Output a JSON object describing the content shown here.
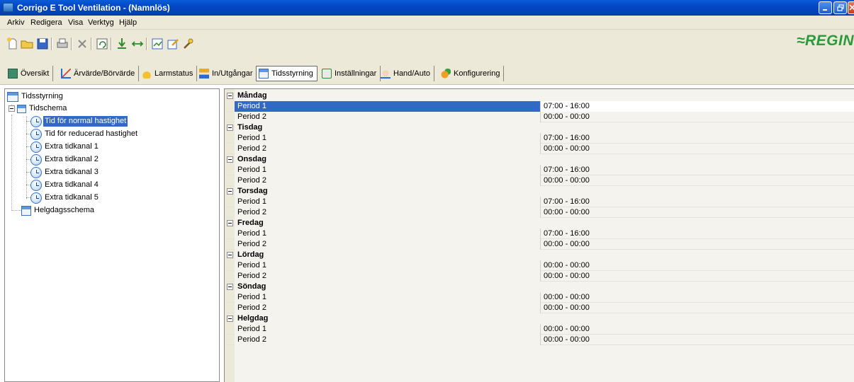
{
  "window": {
    "title": "Corrigo E Tool Ventilation - (Namnlös)"
  },
  "menu": [
    "Arkiv",
    "Redigera",
    "Visa",
    "Verktyg",
    "Hjälp"
  ],
  "brand": {
    "logo_text": "≈REGIN",
    "color": "#2a9a3a"
  },
  "tabs": [
    {
      "label": "Översikt",
      "icon": "overview-icon"
    },
    {
      "label": "Ärvärde/Börvärde",
      "icon": "setpoint-icon"
    },
    {
      "label": "Larmstatus",
      "icon": "alarm-bell-icon"
    },
    {
      "label": "In/Utgångar",
      "icon": "io-icon"
    },
    {
      "label": "Tidsstyrning",
      "icon": "calendar-icon",
      "active": true
    },
    {
      "label": "Inställningar",
      "icon": "settings-icon"
    },
    {
      "label": "Hand/Auto",
      "icon": "hand-icon"
    },
    {
      "label": "Konfigurering",
      "icon": "config-icon"
    }
  ],
  "tree": {
    "root": "Tidsstyrning",
    "schedule": "Tidschema",
    "items": [
      "Tid för normal hastighet",
      "Tid för reducerad hastighet",
      "Extra tidkanal 1",
      "Extra tidkanal 2",
      "Extra tidkanal 3",
      "Extra tidkanal 4",
      "Extra tidkanal 5"
    ],
    "holiday": "Helgdagsschema",
    "selected_index": 0
  },
  "days": [
    {
      "name": "Måndag",
      "periods": [
        {
          "label": "Period 1",
          "value": "07:00 - 16:00"
        },
        {
          "label": "Period 2",
          "value": "00:00 - 00:00"
        }
      ]
    },
    {
      "name": "Tisdag",
      "periods": [
        {
          "label": "Period 1",
          "value": "07:00 - 16:00"
        },
        {
          "label": "Period 2",
          "value": "00:00 - 00:00"
        }
      ]
    },
    {
      "name": "Onsdag",
      "periods": [
        {
          "label": "Period 1",
          "value": "07:00 - 16:00"
        },
        {
          "label": "Period 2",
          "value": "00:00 - 00:00"
        }
      ]
    },
    {
      "name": "Torsdag",
      "periods": [
        {
          "label": "Period 1",
          "value": "07:00 - 16:00"
        },
        {
          "label": "Period 2",
          "value": "00:00 - 00:00"
        }
      ]
    },
    {
      "name": "Fredag",
      "periods": [
        {
          "label": "Period 1",
          "value": "07:00 - 16:00"
        },
        {
          "label": "Period 2",
          "value": "00:00 - 00:00"
        }
      ]
    },
    {
      "name": "Lördag",
      "periods": [
        {
          "label": "Period 1",
          "value": "00:00 - 00:00"
        },
        {
          "label": "Period 2",
          "value": "00:00 - 00:00"
        }
      ]
    },
    {
      "name": "Söndag",
      "periods": [
        {
          "label": "Period 1",
          "value": "00:00 - 00:00"
        },
        {
          "label": "Period 2",
          "value": "00:00 - 00:00"
        }
      ]
    },
    {
      "name": "Helgdag",
      "periods": [
        {
          "label": "Period 1",
          "value": "00:00 - 00:00"
        },
        {
          "label": "Period 2",
          "value": "00:00 - 00:00"
        }
      ]
    }
  ]
}
